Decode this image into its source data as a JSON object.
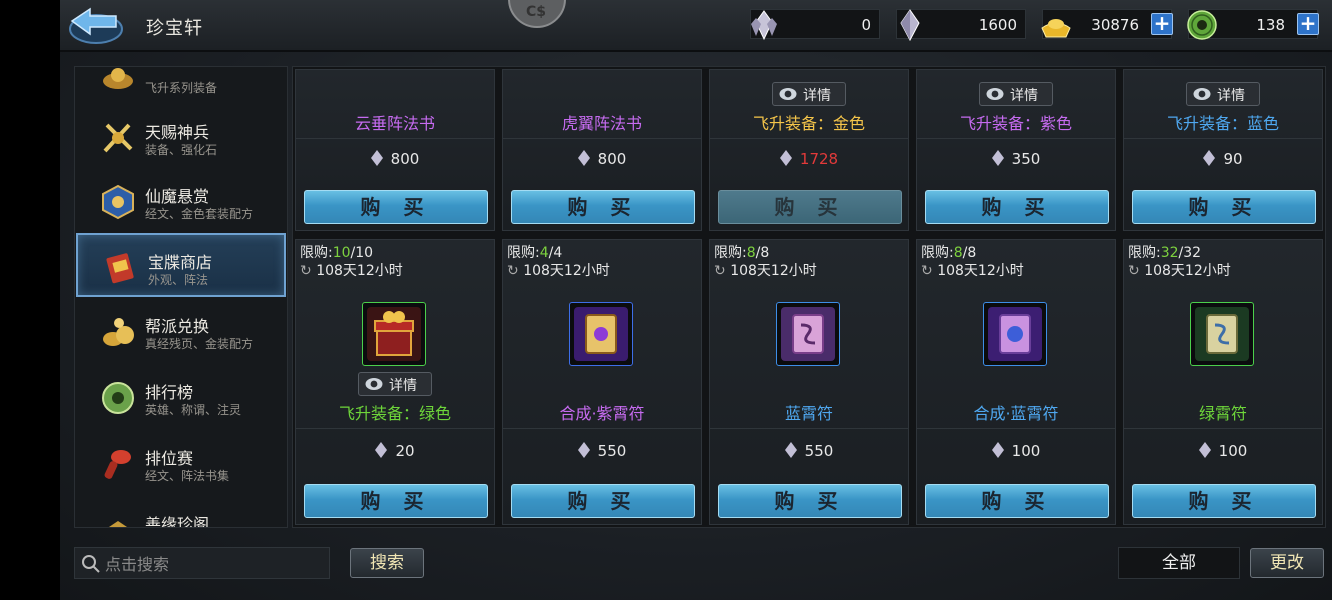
{
  "header": {
    "title": "珍宝轩",
    "ornament_text": "C$",
    "currencies": [
      {
        "icon": "crystal-cluster-icon",
        "value": "0",
        "has_plus": false
      },
      {
        "icon": "crystal-icon",
        "value": "1600",
        "has_plus": false
      },
      {
        "icon": "gold-ingot-icon",
        "value": "30876",
        "has_plus": true
      },
      {
        "icon": "jade-coin-icon",
        "value": "138",
        "has_plus": true
      }
    ],
    "plus_label": "+"
  },
  "sidebar": {
    "items": [
      {
        "name": "",
        "sub": "飞升系列装备",
        "icon": "treasure-icon"
      },
      {
        "name": "天赐神兵",
        "sub": "装备、强化石",
        "icon": "weapons-icon"
      },
      {
        "name": "仙魔悬赏",
        "sub": "经文、金色套装配方",
        "icon": "bounty-icon"
      },
      {
        "name": "宝牒商店",
        "sub": "外观、阵法",
        "icon": "scroll-shop-icon"
      },
      {
        "name": "帮派兑换",
        "sub": "真经残页、金装配方",
        "icon": "gang-exchange-icon"
      },
      {
        "name": "排行榜",
        "sub": "英雄、称谓、注灵",
        "icon": "ranking-icon"
      },
      {
        "name": "排位赛",
        "sub": "经文、阵法书集",
        "icon": "ranked-match-icon"
      },
      {
        "name": "善缘珍阁",
        "sub": "",
        "icon": "pavilion-icon"
      }
    ]
  },
  "shop": {
    "buy_label": "购 买",
    "details_label": "详情",
    "limit_prefix": "限购:",
    "top_row": [
      {
        "name": "云垂阵法书",
        "name_color": "#c66bf0",
        "price": "800",
        "price_color": "#e8e8e8",
        "details": false,
        "disabled": false
      },
      {
        "name": "虎翼阵法书",
        "name_color": "#c66bf0",
        "price": "800",
        "price_color": "#e8e8e8",
        "details": false,
        "disabled": false
      },
      {
        "name": "飞升装备：金色",
        "name_color": "#f5c54a",
        "price": "1728",
        "price_color": "#e23a3a",
        "details": true,
        "disabled": true
      },
      {
        "name": "飞升装备：紫色",
        "name_color": "#c66bf0",
        "price": "350",
        "price_color": "#e8e8e8",
        "details": true,
        "disabled": false
      },
      {
        "name": "飞升装备：蓝色",
        "name_color": "#4fa8f0",
        "price": "90",
        "price_color": "#e8e8e8",
        "details": true,
        "disabled": false
      }
    ],
    "bottom_row": [
      {
        "name": "飞升装备：绿色",
        "name_color": "#6ed63a",
        "price": "20",
        "limit_used": "10",
        "limit_total": "/10",
        "timer": "108天12小时",
        "details": true,
        "item_icon": "gift-box-icon",
        "frame": "#4bd04b"
      },
      {
        "name": "合成·紫霄符",
        "name_color": "#c66bf0",
        "price": "550",
        "limit_used": "4",
        "limit_total": "/4",
        "timer": "108天12小时",
        "details": false,
        "item_icon": "purple-scroll-icon",
        "frame": "#3d6ee8"
      },
      {
        "name": "蓝霄符",
        "name_color": "#4fa8f0",
        "price": "550",
        "limit_used": "8",
        "limit_total": "/8",
        "timer": "108天12小时",
        "details": false,
        "item_icon": "blue-talisman-icon",
        "frame": "#3d8ee8"
      },
      {
        "name": "合成·蓝霄符",
        "name_color": "#4fa8f0",
        "price": "100",
        "limit_used": "8",
        "limit_total": "/8",
        "timer": "108天12小时",
        "details": false,
        "item_icon": "blue-scroll-icon",
        "frame": "#3d8ee8"
      },
      {
        "name": "绿霄符",
        "name_color": "#6ed63a",
        "price": "100",
        "limit_used": "32",
        "limit_total": "/32",
        "timer": "108天12小时",
        "details": false,
        "item_icon": "green-talisman-icon",
        "frame": "#4bd04b"
      }
    ]
  },
  "bottom": {
    "search_placeholder": "点击搜索",
    "search_button": "搜索",
    "filter_value": "全部",
    "change_button": "更改"
  }
}
